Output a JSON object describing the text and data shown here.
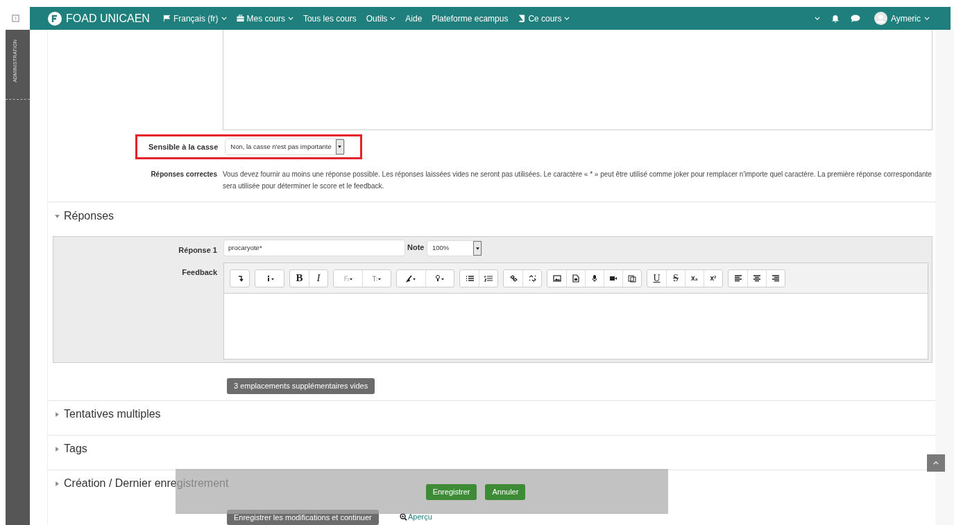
{
  "sidebar": {
    "label": "ADMINISTRATION"
  },
  "navbar": {
    "brand": "FOAD UNICAEN",
    "items": [
      {
        "kind": "flag",
        "label": "Français (fr)",
        "dropdown": true
      },
      {
        "kind": "briefcase",
        "label": "Mes cours",
        "dropdown": true
      },
      {
        "kind": "none",
        "label": "Tous les cours",
        "dropdown": false
      },
      {
        "kind": "none",
        "label": "Outils",
        "dropdown": true
      },
      {
        "kind": "none",
        "label": "Aide",
        "dropdown": false
      },
      {
        "kind": "none",
        "label": "Plateforme ecampus",
        "dropdown": false
      },
      {
        "kind": "book",
        "label": "Ce cours",
        "dropdown": true
      }
    ],
    "user": "Aymeric"
  },
  "case_sensitive": {
    "label": "Sensible à la casse",
    "value": "Non, la casse n'est pas importante",
    "highlighted": true
  },
  "correct_answers": {
    "label": "Réponses correctes",
    "text": "Vous devez fournir au moins une réponse possible. Les réponses laissées vides ne seront pas utilisées. Le caractère « * » peut être utilisé comme joker pour remplacer n'importe quel caractère. La première réponse correspondante sera utilisée pour déterminer le score et le feedback."
  },
  "sections": [
    {
      "title": "Réponses",
      "expanded": true
    },
    {
      "title": "Tentatives multiples",
      "expanded": false
    },
    {
      "title": "Tags",
      "expanded": false
    },
    {
      "title": "Création / Dernier enregistrement",
      "expanded": false
    }
  ],
  "answer": {
    "label": "Réponse 1",
    "value": "procaryote*",
    "grade_label": "Note",
    "grade": "100%",
    "feedback_label": "Feedback"
  },
  "toolbar": [
    [
      {
        "kind": "arrow"
      }
    ],
    [
      {
        "kind": "info"
      }
    ],
    [
      {
        "kind": "bold",
        "glyph": "B"
      },
      {
        "kind": "italic",
        "glyph": "I"
      }
    ],
    [
      {
        "kind": "font"
      },
      {
        "kind": "size"
      }
    ],
    [
      {
        "kind": "brush"
      },
      {
        "kind": "bulb"
      }
    ],
    [
      {
        "kind": "ul"
      },
      {
        "kind": "ol"
      }
    ],
    [
      {
        "kind": "link"
      },
      {
        "kind": "unlink"
      }
    ],
    [
      {
        "kind": "image"
      },
      {
        "kind": "file"
      },
      {
        "kind": "mic"
      },
      {
        "kind": "video"
      },
      {
        "kind": "paste"
      }
    ],
    [
      {
        "kind": "underline",
        "glyph": "U"
      },
      {
        "kind": "strike",
        "glyph": "S"
      },
      {
        "kind": "subscript",
        "glyph": "x₂"
      },
      {
        "kind": "superscript",
        "glyph": "x²"
      }
    ],
    [
      {
        "kind": "left"
      },
      {
        "kind": "center"
      },
      {
        "kind": "right"
      }
    ]
  ],
  "add_blanks_button": "3 emplacements supplémentaires vides",
  "overlay_buttons": [
    "Enregistrer",
    "Annuler"
  ],
  "save_continue_button": "Enregistrer les modifications et continuer",
  "preview_link": "Aperçu"
}
